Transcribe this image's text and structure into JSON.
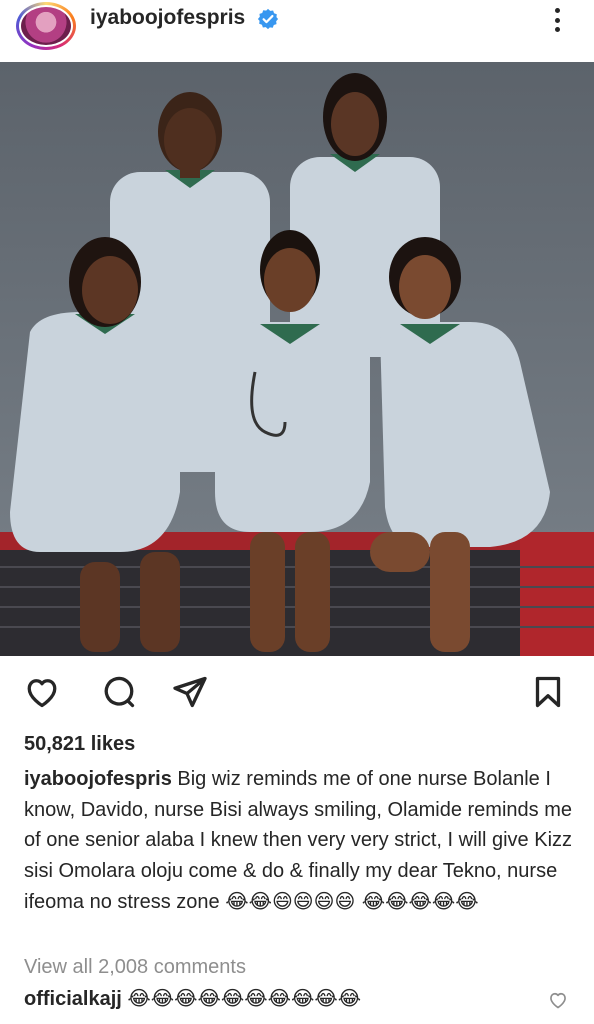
{
  "post": {
    "username": "iyaboojofespris",
    "verified": true,
    "likes": "50,821 likes",
    "caption_user": "iyaboojofespris",
    "caption_text": "Big wiz reminds me of one nurse Bolanle I know, Davido, nurse Bisi always smiling, Olamide reminds me of one senior alaba I knew then very very strict, I will give Kizz sisi Omolara oloju come & do & finally my dear Tekno, nurse ifeoma no stress zone",
    "caption_emojis": "😂😂😄😄😄😄 😂😂😂😂😂",
    "view_all_comments": "View all 2,008 comments",
    "comment": {
      "user": "officialkajj",
      "text": "😂😂😂😂😂😂😂😂😂😂"
    }
  },
  "icons": {
    "avatar": "avatar",
    "verified": "verified-badge-icon",
    "more": "more-options-icon",
    "like": "heart-icon",
    "comment": "comment-bubble-icon",
    "share": "paper-plane-icon",
    "save": "bookmark-icon",
    "comment_like": "heart-outline-icon"
  },
  "colors": {
    "verified_blue": "#3897f0",
    "text": "#262626",
    "muted": "#8e8e8e",
    "uniform": "#c9d3dc",
    "collar": "#2f6b4f",
    "backdrop": "#6a7179"
  }
}
